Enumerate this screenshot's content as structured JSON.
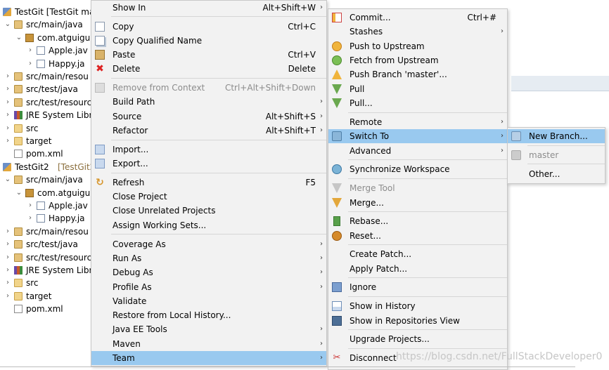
{
  "tree": {
    "items": [
      {
        "label": "TestGit [TestGit ma",
        "twisty": "",
        "icon": "project-icon",
        "indent": 0
      },
      {
        "label": "src/main/java",
        "twisty": "⌄",
        "icon": "source-folder-icon",
        "indent": 1
      },
      {
        "label": "com.atguigu",
        "twisty": "⌄",
        "icon": "package-icon",
        "indent": 2
      },
      {
        "label": "Apple.jav",
        "twisty": "›",
        "icon": "java-file-icon",
        "indent": 3
      },
      {
        "label": "Happy.ja",
        "twisty": "›",
        "icon": "java-file-icon",
        "indent": 3
      },
      {
        "label": "src/main/resou",
        "twisty": "›",
        "icon": "source-folder-icon",
        "indent": 1
      },
      {
        "label": "src/test/java",
        "twisty": "›",
        "icon": "source-folder-icon",
        "indent": 1
      },
      {
        "label": "src/test/resourc",
        "twisty": "›",
        "icon": "source-folder-icon",
        "indent": 1
      },
      {
        "label": "JRE System Libr",
        "twisty": "›",
        "icon": "library-icon",
        "indent": 1
      },
      {
        "label": "src",
        "twisty": "›",
        "icon": "folder-icon",
        "indent": 1
      },
      {
        "label": "target",
        "twisty": "›",
        "icon": "folder-icon",
        "indent": 1
      },
      {
        "label": "pom.xml",
        "twisty": "",
        "icon": "xml-file-icon",
        "indent": 1
      },
      {
        "label": "TestGit2",
        "decoration": "[TestGit2",
        "twisty": "",
        "icon": "project-icon",
        "indent": 0
      },
      {
        "label": "src/main/java",
        "twisty": "⌄",
        "icon": "source-folder-icon",
        "indent": 1
      },
      {
        "label": "com.atguigu",
        "twisty": "⌄",
        "icon": "package-icon",
        "indent": 2
      },
      {
        "label": "Apple.jav",
        "twisty": "›",
        "icon": "java-file-icon",
        "indent": 3
      },
      {
        "label": "Happy.ja",
        "twisty": "›",
        "icon": "java-file-icon",
        "indent": 3
      },
      {
        "label": "src/main/resou",
        "twisty": "›",
        "icon": "source-folder-icon",
        "indent": 1
      },
      {
        "label": "src/test/java",
        "twisty": "›",
        "icon": "source-folder-icon",
        "indent": 1
      },
      {
        "label": "src/test/resourc",
        "twisty": "›",
        "icon": "source-folder-icon",
        "indent": 1
      },
      {
        "label": "JRE System Libr",
        "twisty": "›",
        "icon": "library-icon",
        "indent": 1
      },
      {
        "label": "src",
        "twisty": "›",
        "icon": "folder-icon",
        "indent": 1
      },
      {
        "label": "target",
        "twisty": "›",
        "icon": "folder-icon",
        "indent": 1
      },
      {
        "label": "pom.xml",
        "twisty": "",
        "icon": "xml-file-icon",
        "indent": 1
      }
    ]
  },
  "context_menu": {
    "show_in": {
      "label": "Show In",
      "accel": "Alt+Shift+W"
    },
    "copy": {
      "label": "Copy",
      "accel": "Ctrl+C"
    },
    "copy_qualified": {
      "label": "Copy Qualified Name"
    },
    "paste": {
      "label": "Paste",
      "accel": "Ctrl+V"
    },
    "delete": {
      "label": "Delete",
      "accel": "Delete"
    },
    "remove_context": {
      "label": "Remove from Context",
      "accel": "Ctrl+Alt+Shift+Down"
    },
    "build_path": {
      "label": "Build Path"
    },
    "source": {
      "label": "Source",
      "accel": "Alt+Shift+S"
    },
    "refactor": {
      "label": "Refactor",
      "accel": "Alt+Shift+T"
    },
    "import": {
      "label": "Import..."
    },
    "export": {
      "label": "Export..."
    },
    "refresh": {
      "label": "Refresh",
      "accel": "F5"
    },
    "close_project": {
      "label": "Close Project"
    },
    "close_unrelated": {
      "label": "Close Unrelated Projects"
    },
    "assign_working_sets": {
      "label": "Assign Working Sets..."
    },
    "coverage_as": {
      "label": "Coverage As"
    },
    "run_as": {
      "label": "Run As"
    },
    "debug_as": {
      "label": "Debug As"
    },
    "profile_as": {
      "label": "Profile As"
    },
    "validate": {
      "label": "Validate"
    },
    "restore_history": {
      "label": "Restore from Local History..."
    },
    "java_ee_tools": {
      "label": "Java EE Tools"
    },
    "maven": {
      "label": "Maven"
    },
    "team": {
      "label": "Team"
    }
  },
  "team_menu": {
    "commit": {
      "label": "Commit...",
      "accel": "Ctrl+#"
    },
    "stashes": {
      "label": "Stashes"
    },
    "push_upstream": {
      "label": "Push to Upstream"
    },
    "fetch_upstream": {
      "label": "Fetch from Upstream"
    },
    "push_branch": {
      "label": "Push Branch 'master'..."
    },
    "pull": {
      "label": "Pull"
    },
    "pull_dots": {
      "label": "Pull..."
    },
    "remote": {
      "label": "Remote"
    },
    "switch_to": {
      "label": "Switch To"
    },
    "advanced": {
      "label": "Advanced"
    },
    "sync_workspace": {
      "label": "Synchronize Workspace"
    },
    "merge_tool": {
      "label": "Merge Tool"
    },
    "merge": {
      "label": "Merge..."
    },
    "rebase": {
      "label": "Rebase..."
    },
    "reset": {
      "label": "Reset..."
    },
    "create_patch": {
      "label": "Create Patch..."
    },
    "apply_patch": {
      "label": "Apply Patch..."
    },
    "ignore": {
      "label": "Ignore"
    },
    "show_history": {
      "label": "Show in History"
    },
    "show_repos": {
      "label": "Show in Repositories View"
    },
    "upgrade_projects": {
      "label": "Upgrade Projects..."
    },
    "disconnect": {
      "label": "Disconnect"
    }
  },
  "switch_menu": {
    "new_branch": {
      "label": "New Branch..."
    },
    "master": {
      "label": "master"
    },
    "other": {
      "label": "Other..."
    }
  },
  "watermark": "https://blog.csdn.net/FullStackDeveloper0",
  "colors": {
    "highlight": "#99c9ef",
    "menu_bg": "#f2f2f2"
  }
}
